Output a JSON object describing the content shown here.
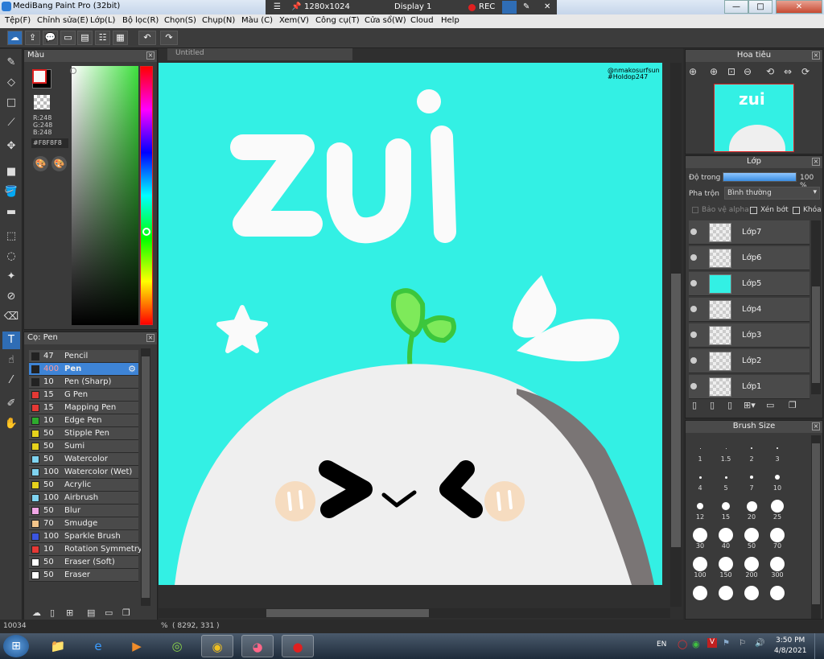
{
  "window": {
    "title": "MediBang Paint Pro (32bit)",
    "resolution": "1280x1024",
    "display": "Display 1",
    "rec": "REC"
  },
  "window_buttons": {
    "minimize": "—",
    "maximize": "□",
    "close": "✕"
  },
  "menu": [
    "Tệp(F)",
    "Chỉnh sửa(E)",
    "Lớp(L)",
    "Bộ lọc(R)",
    "Chọn(S)",
    "Chụp(N)",
    "Màu (C)",
    "Xem(V)",
    "Công cụ(T)",
    "Cửa sổ(W)",
    "Cloud",
    "Help"
  ],
  "color_panel": {
    "title": "Màu",
    "r": "R:248",
    "g": "G:248",
    "b": "B:248",
    "hex": "#F8F8F8"
  },
  "brush_panel": {
    "title": "Cọ: Pen",
    "brushes": [
      {
        "size": "47",
        "name": "Pencil",
        "color": "#222222"
      },
      {
        "size": "400",
        "name": "Pen",
        "color": "#222222"
      },
      {
        "size": "10",
        "name": "Pen (Sharp)",
        "color": "#222222"
      },
      {
        "size": "15",
        "name": "G Pen",
        "color": "#e53935"
      },
      {
        "size": "15",
        "name": "Mapping Pen",
        "color": "#e53935"
      },
      {
        "size": "10",
        "name": "Edge Pen",
        "color": "#2eab2e"
      },
      {
        "size": "50",
        "name": "Stipple Pen",
        "color": "#e6d21c"
      },
      {
        "size": "50",
        "name": "Sumi",
        "color": "#e6d21c"
      },
      {
        "size": "50",
        "name": "Watercolor",
        "color": "#7fd3f0"
      },
      {
        "size": "100",
        "name": "Watercolor (Wet)",
        "color": "#7fd3f0"
      },
      {
        "size": "50",
        "name": "Acrylic",
        "color": "#e6d21c"
      },
      {
        "size": "100",
        "name": "Airbrush",
        "color": "#7fd3f0"
      },
      {
        "size": "50",
        "name": "Blur",
        "color": "#f0a6e6"
      },
      {
        "size": "70",
        "name": "Smudge",
        "color": "#f2c48a"
      },
      {
        "size": "100",
        "name": "Sparkle Brush",
        "color": "#3b55e0"
      },
      {
        "size": "10",
        "name": "Rotation Symmetry P",
        "color": "#e53935"
      },
      {
        "size": "50",
        "name": "Eraser (Soft)",
        "color": "#ffffff"
      },
      {
        "size": "50",
        "name": "Eraser",
        "color": "#ffffff"
      }
    ]
  },
  "document": {
    "tab": "Untitled",
    "watermark1": "@nmakosurfsun",
    "watermark2": "#Holdop247",
    "text": "zui"
  },
  "navigator": {
    "title": "Hoa tiêu"
  },
  "layers": {
    "title": "Lớp",
    "opacity_label": "Độ trong",
    "opacity_value": "100 %",
    "opacity": 1.0,
    "blend_label": "Pha trộn",
    "blend_value": "Bình thường",
    "protect_alpha": "Bảo vệ alpha",
    "clipping": "Xén bớt",
    "lock": "Khóa",
    "items": [
      "Lớp7",
      "Lớp6",
      "Lớp5",
      "Lớp4",
      "Lớp3",
      "Lớp2",
      "Lớp1"
    ]
  },
  "brush_size": {
    "title": "Brush Size",
    "sizes": [
      {
        "label": "1",
        "d": 1
      },
      {
        "label": "1.5",
        "d": 1
      },
      {
        "label": "2",
        "d": 2
      },
      {
        "label": "3",
        "d": 2
      },
      {
        "label": "4",
        "d": 3
      },
      {
        "label": "5",
        "d": 3
      },
      {
        "label": "7",
        "d": 4
      },
      {
        "label": "10",
        "d": 6
      },
      {
        "label": "12",
        "d": 8
      },
      {
        "label": "15",
        "d": 10
      },
      {
        "label": "20",
        "d": 13
      },
      {
        "label": "25",
        "d": 16
      },
      {
        "label": "30",
        "d": 18
      },
      {
        "label": "40",
        "d": 18
      },
      {
        "label": "50",
        "d": 18
      },
      {
        "label": "70",
        "d": 18
      },
      {
        "label": "100",
        "d": 18
      },
      {
        "label": "150",
        "d": 18
      },
      {
        "label": "200",
        "d": 18
      },
      {
        "label": "300",
        "d": 18
      },
      {
        "label": "",
        "d": 18
      },
      {
        "label": "",
        "d": 18
      },
      {
        "label": "",
        "d": 18
      },
      {
        "label": "",
        "d": 18
      }
    ]
  },
  "status": {
    "zoom": "10034",
    "unit": "%",
    "coords": "( 8292, 331 )"
  },
  "taskbar": {
    "lang": "EN",
    "time": "3:50 PM",
    "date": "4/8/2021"
  }
}
